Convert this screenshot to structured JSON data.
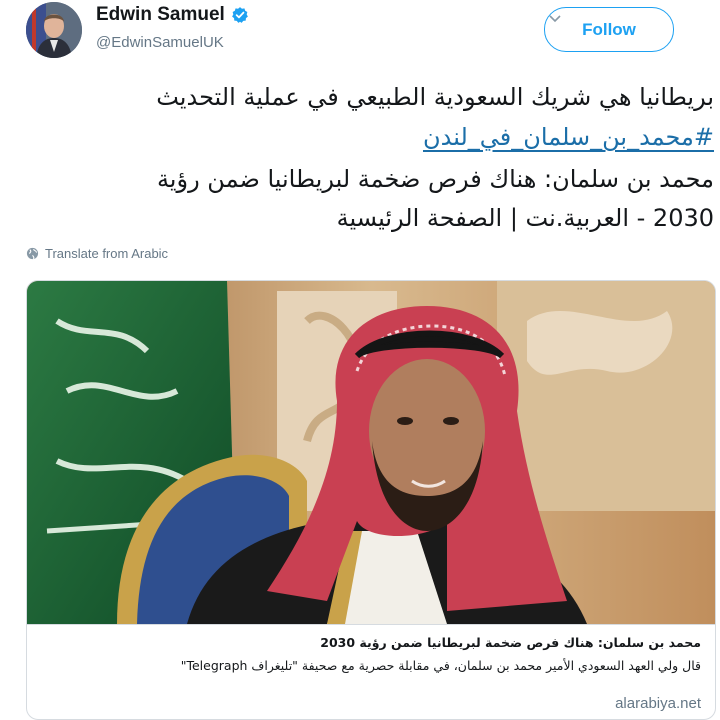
{
  "tweet": {
    "author": {
      "display_name": "Edwin Samuel",
      "handle": "@EdwinSamuelUK",
      "verified": true,
      "avatar_icon": "avatar-photo"
    },
    "follow_label": "Follow",
    "text_lines": [
      "بريطانيا هي شريك السعودية الطبيعي في عملية التحديث",
      "#محمد_بن_سلمان_في_لندن",
      "محمد بن سلمان: هناك فرص ضخمة لبريطانيا ضمن رؤية",
      "2030 - العربية.نت | الصفحة الرئيسية"
    ],
    "translate_label": "Translate from Arabic",
    "link_card": {
      "image_icon": "card-photo",
      "title": "محمد بن سلمان: هناك فرص ضخمة لبريطانيا ضمن رؤية 2030",
      "description": "قال ولي العهد السعودي الأمير محمد بن سلمان، في مقابلة حصرية مع صحيفة \"تليغراف Telegraph\"",
      "domain": "alarabiya.net"
    }
  },
  "colors": {
    "accent": "#1da1f2",
    "hashtag": "#1b6ea8",
    "secondary_text": "#657786",
    "border": "#d6dbe0"
  }
}
